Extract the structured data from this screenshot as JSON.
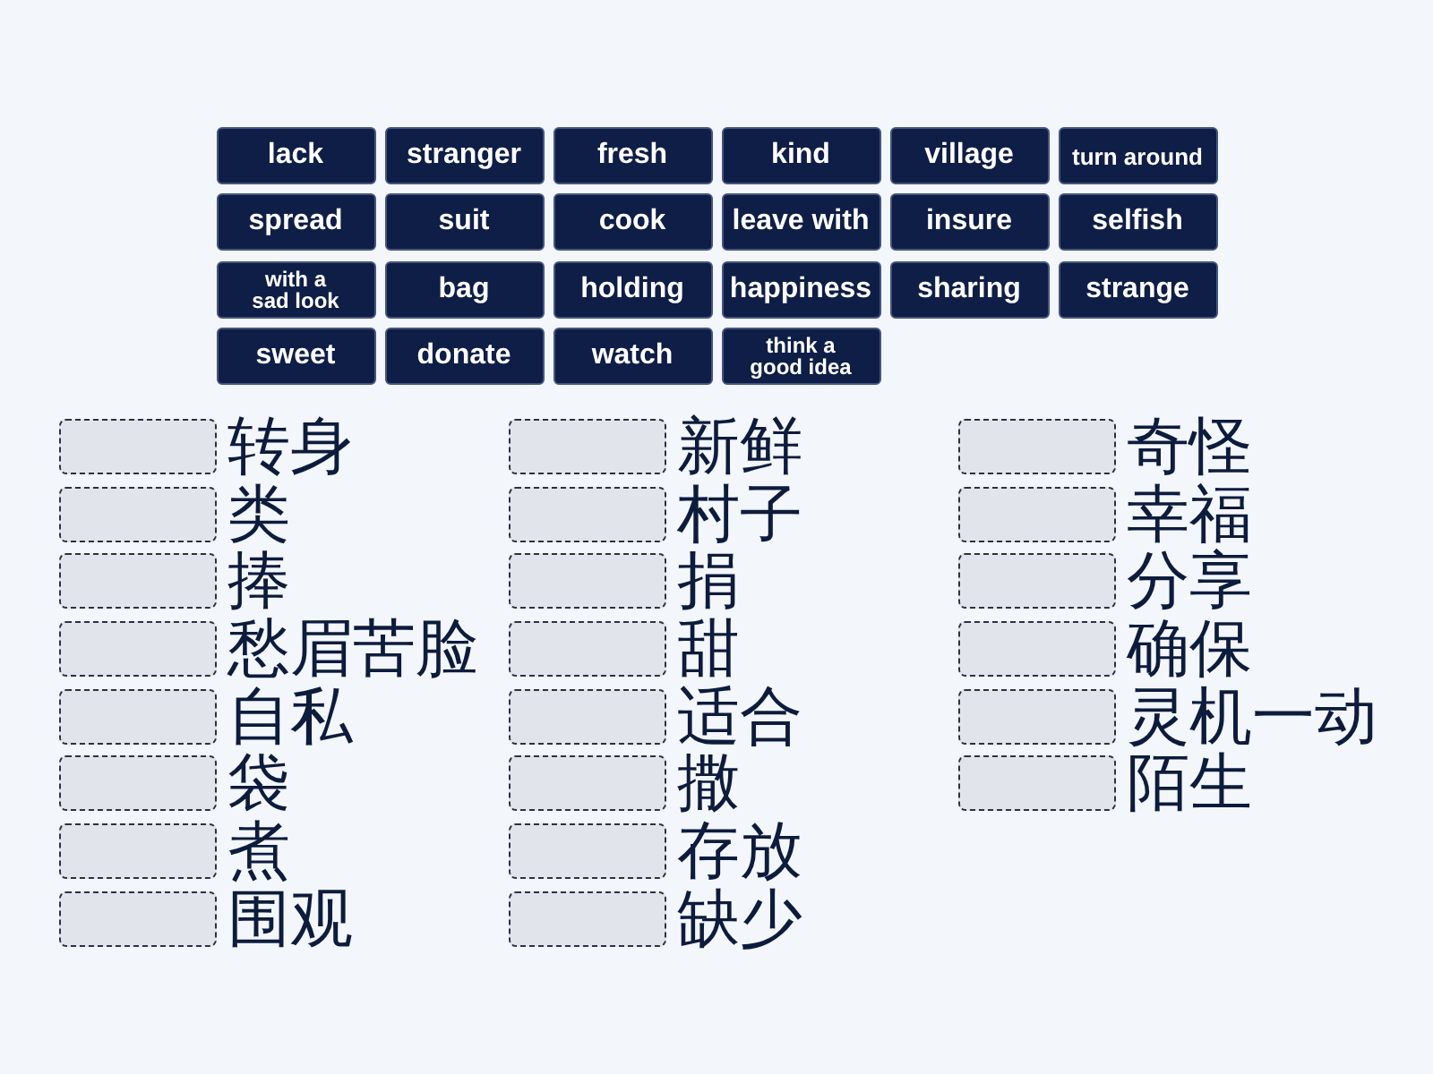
{
  "tiles": [
    {
      "label": "lack",
      "kind": "word"
    },
    {
      "label": "stranger",
      "kind": "word"
    },
    {
      "label": "fresh",
      "kind": "word"
    },
    {
      "label": "kind",
      "kind": "word"
    },
    {
      "label": "village",
      "kind": "word"
    },
    {
      "label": "turn around",
      "kind": "compact"
    },
    {
      "label": "spread",
      "kind": "word"
    },
    {
      "label": "suit",
      "kind": "word"
    },
    {
      "label": "cook",
      "kind": "word"
    },
    {
      "label": "leave with",
      "kind": "word"
    },
    {
      "label": "insure",
      "kind": "word"
    },
    {
      "label": "selfish",
      "kind": "word"
    },
    {
      "label": "with a sad look",
      "kind": "wrapped"
    },
    {
      "label": "bag",
      "kind": "word"
    },
    {
      "label": "holding",
      "kind": "word"
    },
    {
      "label": "happiness",
      "kind": "word"
    },
    {
      "label": "sharing",
      "kind": "word"
    },
    {
      "label": "strange",
      "kind": "word"
    },
    {
      "label": "sweet",
      "kind": "word"
    },
    {
      "label": "donate",
      "kind": "word"
    },
    {
      "label": "watch",
      "kind": "word"
    },
    {
      "label": "think a good idea",
      "kind": "wrapped"
    }
  ],
  "answer_columns": [
    {
      "items": [
        {
          "prompt": "转身"
        },
        {
          "prompt": "类"
        },
        {
          "prompt": "捧"
        },
        {
          "prompt": "愁眉苦脸"
        },
        {
          "prompt": "自私"
        },
        {
          "prompt": "袋"
        },
        {
          "prompt": "煮"
        },
        {
          "prompt": "围观"
        }
      ]
    },
    {
      "items": [
        {
          "prompt": "新鲜"
        },
        {
          "prompt": "村子"
        },
        {
          "prompt": "捐"
        },
        {
          "prompt": "甜"
        },
        {
          "prompt": "适合"
        },
        {
          "prompt": "撒"
        },
        {
          "prompt": "存放"
        },
        {
          "prompt": "缺少"
        }
      ]
    },
    {
      "items": [
        {
          "prompt": "奇怪"
        },
        {
          "prompt": "幸福"
        },
        {
          "prompt": "分享"
        },
        {
          "prompt": "确保"
        },
        {
          "prompt": "灵机一动"
        },
        {
          "prompt": "陌生"
        }
      ]
    }
  ]
}
